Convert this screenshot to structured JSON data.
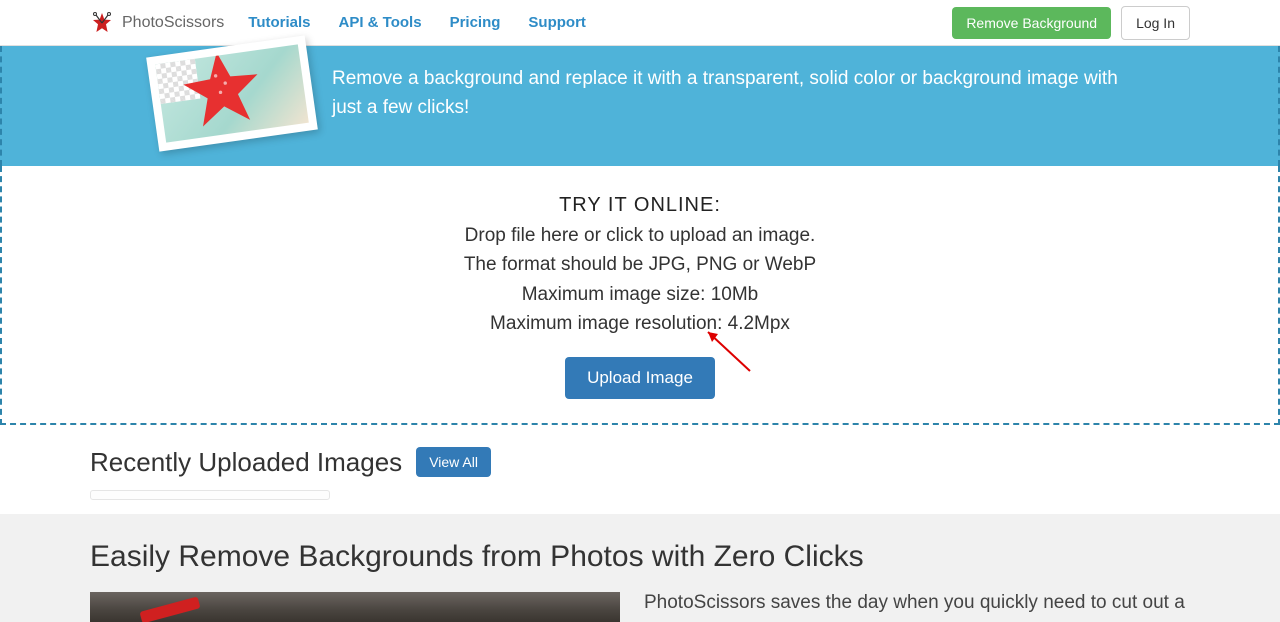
{
  "header": {
    "logo_text": "PhotoScissors",
    "nav": [
      "Tutorials",
      "API & Tools",
      "Pricing",
      "Support"
    ],
    "remove_bg_label": "Remove Background",
    "login_label": "Log In"
  },
  "hero": {
    "text": "Remove a background and replace it with a transparent, solid color or background image with just a few clicks!"
  },
  "try": {
    "title": "TRY IT ONLINE:",
    "line1": "Drop file here or click to upload an image.",
    "line2": "The format should be JPG, PNG or WebP",
    "line3": "Maximum image size: 10Mb",
    "line4": "Maximum image resolution: 4.2Mpx",
    "upload_label": "Upload Image"
  },
  "recent": {
    "title": "Recently Uploaded Images",
    "viewall_label": "View All"
  },
  "bottom": {
    "title": "Easily Remove Backgrounds from Photos with Zero Clicks",
    "text": "PhotoScissors saves the day when you quickly need to cut out a"
  }
}
